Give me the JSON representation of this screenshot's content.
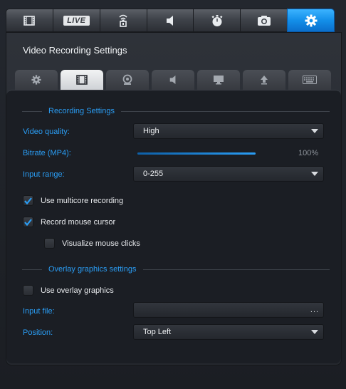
{
  "top_tabs": [
    {
      "name": "film-icon"
    },
    {
      "name": "live-icon",
      "label": "LIVE"
    },
    {
      "name": "antenna-icon"
    },
    {
      "name": "speaker-icon"
    },
    {
      "name": "timer-icon"
    },
    {
      "name": "camera-icon"
    },
    {
      "name": "gear-icon",
      "active": true
    }
  ],
  "panel": {
    "title": "Video Recording Settings",
    "sub_tabs": [
      {
        "name": "gear-icon"
      },
      {
        "name": "film-icon",
        "active": true
      },
      {
        "name": "webcam-icon"
      },
      {
        "name": "speaker-icon"
      },
      {
        "name": "monitor-icon"
      },
      {
        "name": "upload-icon"
      },
      {
        "name": "keyboard-icon"
      }
    ]
  },
  "recording": {
    "section_label": "Recording Settings",
    "video_quality_label": "Video quality:",
    "video_quality_value": "High",
    "bitrate_label": "Bitrate (MP4):",
    "bitrate_value": 1.0,
    "bitrate_text": "100%",
    "input_range_label": "Input range:",
    "input_range_value": "0-255",
    "multicore_label": "Use multicore recording",
    "multicore_checked": true,
    "cursor_label": "Record mouse cursor",
    "cursor_checked": true,
    "clicks_label": "Visualize mouse clicks",
    "clicks_checked": false
  },
  "overlay": {
    "section_label": "Overlay graphics settings",
    "use_label": "Use overlay graphics",
    "use_checked": false,
    "input_file_label": "Input file:",
    "input_file_value": "",
    "browse_label": "...",
    "position_label": "Position:",
    "position_value": "Top Left"
  },
  "colors": {
    "accent": "#2a9df4",
    "active_tab": "#138fe9",
    "background": "#1b1e24"
  }
}
